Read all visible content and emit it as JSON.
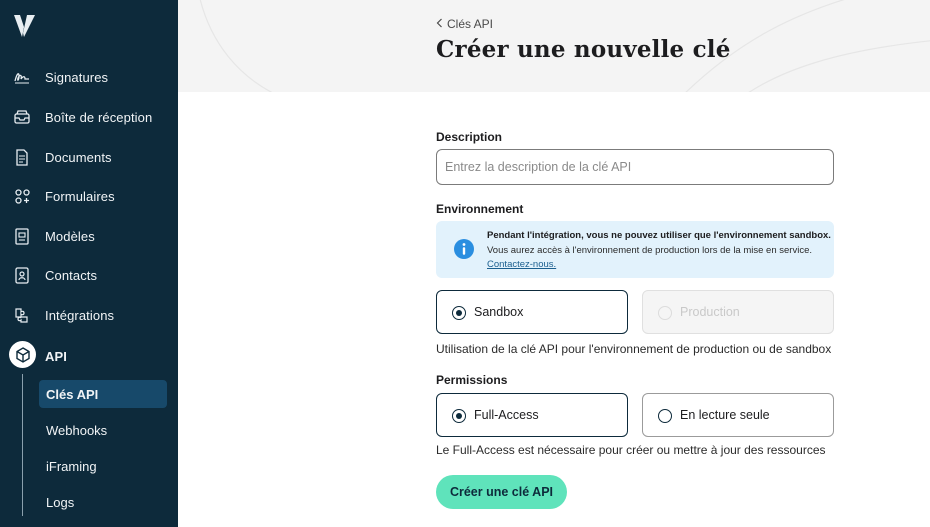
{
  "sidebar": {
    "items": [
      {
        "label": "Signatures",
        "icon": "signature-icon"
      },
      {
        "label": "Boîte de réception",
        "icon": "inbox-icon"
      },
      {
        "label": "Documents",
        "icon": "document-icon"
      },
      {
        "label": "Formulaires",
        "icon": "forms-icon"
      },
      {
        "label": "Modèles",
        "icon": "template-icon"
      },
      {
        "label": "Contacts",
        "icon": "contacts-icon"
      },
      {
        "label": "Intégrations",
        "icon": "integrations-icon"
      },
      {
        "label": "API",
        "icon": "api-icon"
      }
    ],
    "sub_items": [
      {
        "label": "Clés API"
      },
      {
        "label": "Webhooks"
      },
      {
        "label": "iFraming"
      },
      {
        "label": "Logs"
      }
    ]
  },
  "header": {
    "breadcrumb": "Clés API",
    "title": "Créer une nouvelle clé"
  },
  "form": {
    "description_label": "Description",
    "description_placeholder": "Entrez la description de la clé API",
    "description_value": "",
    "environment_label": "Environnement",
    "info": {
      "title": "Pendant l'intégration, vous ne pouvez utiliser que l'environnement sandbox.",
      "text": "Vous aurez accès à l'environnement de production lors de la mise en service.",
      "link": "Contactez-nous."
    },
    "env_options": [
      {
        "label": "Sandbox",
        "selected": true,
        "disabled": false
      },
      {
        "label": "Production",
        "selected": false,
        "disabled": true
      }
    ],
    "env_hint": "Utilisation de la clé API pour l'environnement de production ou de sandbox",
    "permissions_label": "Permissions",
    "perm_options": [
      {
        "label": "Full-Access",
        "selected": true
      },
      {
        "label": "En lecture seule",
        "selected": false
      }
    ],
    "perm_hint": "Le Full-Access est nécessaire pour créer ou mettre à jour des ressources",
    "submit_label": "Créer une clé API"
  },
  "colors": {
    "sidebar_bg": "#0d2a3b",
    "active_sub_bg": "#17496a",
    "accent_button": "#5fe3bb",
    "info_bg": "#e2f2fc",
    "info_icon": "#2a8ee0"
  }
}
